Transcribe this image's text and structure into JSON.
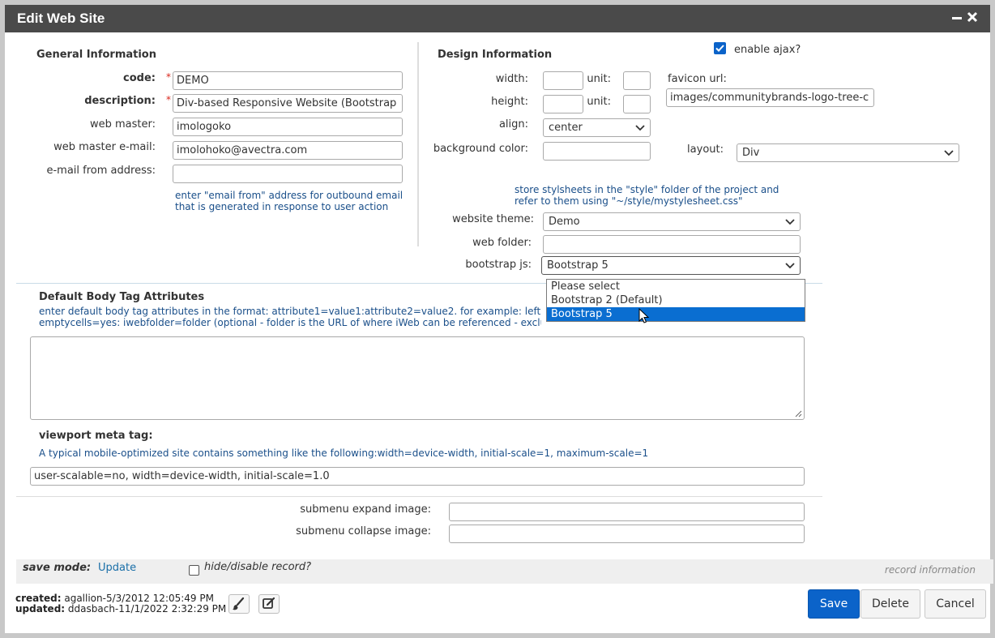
{
  "dialog": {
    "title": "Edit Web Site"
  },
  "general": {
    "heading": "General Information",
    "code_label": "code:",
    "code_value": "DEMO",
    "description_label": "description:",
    "description_value": "Div-based Responsive Website (Bootstrap",
    "webmaster_label": "web master:",
    "webmaster_value": "imologoko",
    "webmaster_email_label": "web master e-mail:",
    "webmaster_email_value": "imolohoko@avectra.com",
    "email_from_label": "e-mail from address:",
    "email_from_value": "",
    "email_from_help_1": "enter \"email from\" address for outbound email",
    "email_from_help_2": "that is generated in response to user action"
  },
  "design": {
    "heading": "Design Information",
    "enable_ajax_label": "enable ajax?",
    "enable_ajax_checked": true,
    "width_label": "width:",
    "height_label": "height:",
    "unit_label": "unit:",
    "align_label": "align:",
    "align_value": "center",
    "bgcolor_label": "background color:",
    "favicon_label": "favicon url:",
    "favicon_value": "images/communitybrands-logo-tree-c",
    "layout_label": "layout:",
    "layout_value": "Div",
    "stylesheet_help_1": "store stylsheets in the \"style\" folder of the project and",
    "stylesheet_help_2": "refer to them using \"~/style/mystylesheet.css\"",
    "theme_label": "website theme:",
    "theme_value": "Demo",
    "webfolder_label": "web folder:",
    "bootstrap_label": "bootstrap js:",
    "bootstrap_value": "Bootstrap 5",
    "bootstrap_options": [
      "Please select",
      "Bootstrap 2 (Default)",
      "Bootstrap 5"
    ],
    "bootstrap_selected_index": 2
  },
  "body_tag": {
    "heading": "Default Body Tag Attributes",
    "help_1": "enter default body tag attributes in the format: attribute1=value1:attribute2=value2. for example: leftma",
    "help_2": "emptycells=yes: iwebfolder=folder (optional - folder is the URL of where iWeb can be referenced - exclude http://)"
  },
  "viewport": {
    "heading": "viewport meta tag:",
    "help": "A typical mobile-optimized site contains something like the following:width=device-width, initial-scale=1, maximum-scale=1",
    "value": "user-scalable=no, width=device-width, initial-scale=1.0"
  },
  "submenu": {
    "expand_label": "submenu expand image:",
    "collapse_label": "submenu collapse image:"
  },
  "footer": {
    "save_mode_label": "save mode:",
    "save_mode_value": "Update",
    "hide_label": "hide/disable record?",
    "record_info": "record information",
    "created_label": "created:",
    "created_value": "agallion-5/3/2012 12:05:49 PM",
    "updated_label": "updated:",
    "updated_value": "ddasbach-11/1/2022 2:32:29 PM",
    "save_button": "Save",
    "delete_button": "Delete",
    "cancel_button": "Cancel"
  },
  "icons": {
    "minimize": "minimize-icon",
    "close": "close-icon",
    "paintbrush": "paintbrush-icon",
    "edit": "edit-icon",
    "chevron": "chevron-down-icon",
    "cursor": "mouse-cursor-icon"
  },
  "colors": {
    "titlebar": "#4a4a4a",
    "primary_button": "#0b63c9",
    "help_text": "#1a4f8a",
    "required": "#d9261c",
    "selected_option": "#0a6ed1"
  }
}
